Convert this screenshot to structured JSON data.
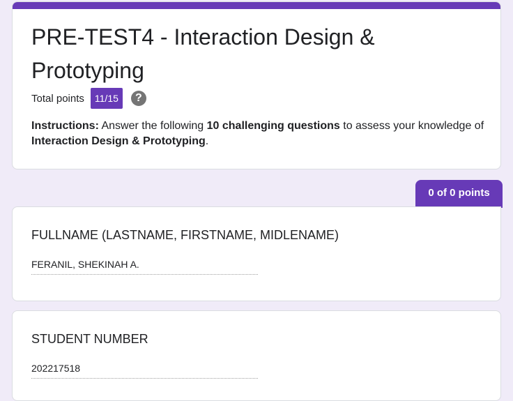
{
  "form": {
    "title": "PRE-TEST4 - Interaction Design & Prototyping",
    "total_points_label": "Total points",
    "score": "11/15",
    "help_icon": "help-circle-icon",
    "accent_color": "#673ab7"
  },
  "instructions": {
    "lead": "Instructions:",
    "part1": " Answer the following ",
    "emphasis1": "10 challenging questions",
    "part2": " to assess your knowledge of ",
    "emphasis2": "Interaction Design & Prototyping",
    "part3": "."
  },
  "section": {
    "score_tab": "0 of 0 points"
  },
  "questions": [
    {
      "title": "FULLNAME (LASTNAME, FIRSTNAME, MIDLENAME)",
      "answer": "FERANIL, SHEKINAH A."
    },
    {
      "title": "STUDENT NUMBER",
      "answer": "202217518"
    }
  ]
}
